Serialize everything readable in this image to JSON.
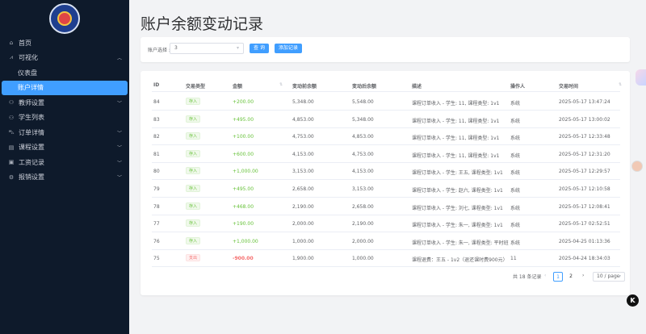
{
  "sidebar": {
    "items": [
      {
        "icon": "home-icon",
        "glyph": "⌂",
        "label": "首页",
        "chevron": ""
      },
      {
        "icon": "chart-icon",
        "glyph": "⩘",
        "label": "可视化",
        "chevron": "︿"
      },
      {
        "icon": "",
        "glyph": "",
        "label": "仪表盘",
        "chevron": "",
        "sub": true
      },
      {
        "icon": "",
        "glyph": "",
        "label": "账户详情",
        "chevron": "",
        "sub": true,
        "active": true
      },
      {
        "icon": "user-icon",
        "glyph": "⚇",
        "label": "教师设置",
        "chevron": "﹀"
      },
      {
        "icon": "student-icon",
        "glyph": "⚇",
        "label": "学生列表",
        "chevron": ""
      },
      {
        "icon": "cart-icon",
        "glyph": "⛍",
        "label": "订单详情",
        "chevron": "﹀"
      },
      {
        "icon": "book-icon",
        "glyph": "▤",
        "label": "课程设置",
        "chevron": "﹀"
      },
      {
        "icon": "wallet-icon",
        "glyph": "▣",
        "label": "工资记录",
        "chevron": "﹀"
      },
      {
        "icon": "setting-icon",
        "glyph": "⚙",
        "label": "报销设置",
        "chevron": "﹀"
      }
    ]
  },
  "page": {
    "title": "账户余额变动记录"
  },
  "filter": {
    "label": "账户选择 :",
    "value": "3",
    "query_btn": "查 询",
    "add_btn": "添加记录"
  },
  "table": {
    "headers": [
      "ID",
      "交易类型",
      "金额",
      "变动前余额",
      "变动后余额",
      "描述",
      "操作人",
      "交易时间"
    ],
    "rows": [
      {
        "id": "84",
        "type": "存入",
        "kind": "in",
        "amount": "+200.00",
        "before": "5,348.00",
        "after": "5,548.00",
        "desc": "课程订单收入 - 学生: 11, 课程类型: 1v1",
        "op": "系统",
        "time": "2025-05-17 13:47:24"
      },
      {
        "id": "83",
        "type": "存入",
        "kind": "in",
        "amount": "+495.00",
        "before": "4,853.00",
        "after": "5,348.00",
        "desc": "课程订单收入 - 学生: 11, 课程类型: 1v1",
        "op": "系统",
        "time": "2025-05-17 13:00:02"
      },
      {
        "id": "82",
        "type": "存入",
        "kind": "in",
        "amount": "+100.00",
        "before": "4,753.00",
        "after": "4,853.00",
        "desc": "课程订单收入 - 学生: 11, 课程类型: 1v1",
        "op": "系统",
        "time": "2025-05-17 12:33:48"
      },
      {
        "id": "81",
        "type": "存入",
        "kind": "in",
        "amount": "+600.00",
        "before": "4,153.00",
        "after": "4,753.00",
        "desc": "课程订单收入 - 学生: 11, 课程类型: 1v1",
        "op": "系统",
        "time": "2025-05-17 12:31:20"
      },
      {
        "id": "80",
        "type": "存入",
        "kind": "in",
        "amount": "+1,000.00",
        "before": "3,153.00",
        "after": "4,153.00",
        "desc": "课程订单收入 - 学生: 王五, 课程类型: 1v1",
        "op": "系统",
        "time": "2025-05-17 12:29:57"
      },
      {
        "id": "79",
        "type": "存入",
        "kind": "in",
        "amount": "+495.00",
        "before": "2,658.00",
        "after": "3,153.00",
        "desc": "课程订单收入 - 学生: 赵六, 课程类型: 1v1",
        "op": "系统",
        "time": "2025-05-17 12:10:58"
      },
      {
        "id": "78",
        "type": "存入",
        "kind": "in",
        "amount": "+468.00",
        "before": "2,190.00",
        "after": "2,658.00",
        "desc": "课程订单收入 - 学生: 刘七, 课程类型: 1v1",
        "op": "系统",
        "time": "2025-05-17 12:08:41"
      },
      {
        "id": "77",
        "type": "存入",
        "kind": "in",
        "amount": "+190.00",
        "before": "2,000.00",
        "after": "2,190.00",
        "desc": "课程订单收入 - 学生: 朱一, 课程类型: 1v1",
        "op": "系统",
        "time": "2025-05-17 02:52:51"
      },
      {
        "id": "76",
        "type": "存入",
        "kind": "in",
        "amount": "+1,000.00",
        "before": "1,000.00",
        "after": "2,000.00",
        "desc": "课程订单收入 - 学生: 朱一, 课程类型: 平时班",
        "op": "系统",
        "time": "2025-04-25 01:13:36"
      },
      {
        "id": "75",
        "type": "支出",
        "kind": "out",
        "amount": "-900.00",
        "before": "1,900.00",
        "after": "1,000.00",
        "desc": "课程退费：王五 - 1v2（退还课时费900元）",
        "op": "11",
        "time": "2025-04-24 18:34:03"
      }
    ]
  },
  "pagination": {
    "total": "共 18 条记录",
    "prev": "‹",
    "pages": [
      "1",
      "2"
    ],
    "next": "›",
    "size": "10 / page"
  },
  "floating": {
    "k_label": "K"
  }
}
